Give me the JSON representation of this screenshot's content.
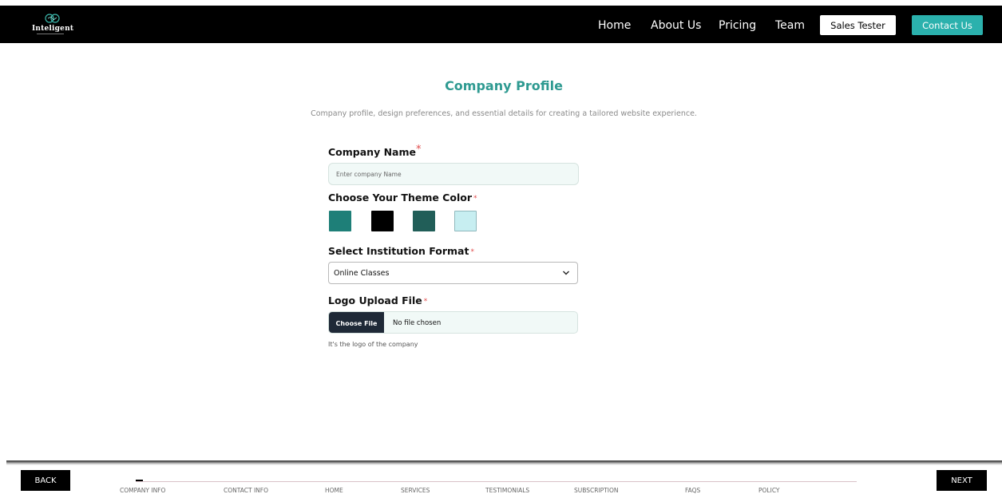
{
  "nav": {
    "logo_text": "Inteligent",
    "links": [
      "Home",
      "About Us",
      "Pricing",
      "Team"
    ],
    "sales_button": "Sales Tester",
    "contact_button": "Contact Us"
  },
  "page": {
    "title": "Company Profile",
    "subtitle": "Company profile, design preferences, and essential details for creating a tailored website experience."
  },
  "form": {
    "company_name": {
      "label": "Company Name",
      "required_mark": "*",
      "value": "",
      "placeholder": "Enter company Name"
    },
    "theme_color": {
      "label": "Choose Your Theme Color",
      "required_mark": "*",
      "swatches": [
        "#1e7f78",
        "#000000",
        "#215e58",
        "#c7eef1"
      ]
    },
    "institution_format": {
      "label": "Select Institution Format",
      "required_mark": "*",
      "selected": "Online Classes"
    },
    "logo_upload": {
      "label": "Logo Upload File",
      "required_mark": "*",
      "button": "Choose File",
      "status": "No file chosen",
      "hint": "It's the logo of the company"
    }
  },
  "footer": {
    "back": "BACK",
    "next": "NEXT",
    "progress_fraction": 0.01,
    "steps": [
      "COMPANY INFO",
      "CONTACT INFO",
      "HOME",
      "SERVICES",
      "TESTIMONIALS",
      "SUBSCRIPTION",
      "FAQS",
      "POLICY"
    ]
  },
  "colors": {
    "accent": "#2bb1ad",
    "title": "#2e9a91",
    "required": "#e04a4a"
  }
}
